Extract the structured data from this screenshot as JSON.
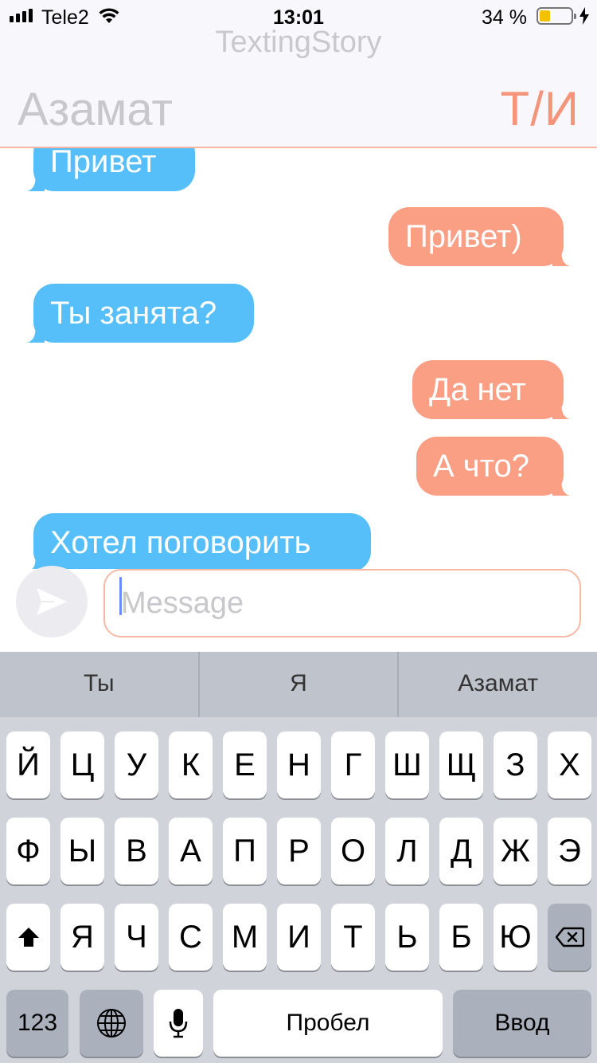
{
  "status_bar": {
    "carrier": "Tele2",
    "time": "13:01",
    "battery_percent_text": "34 %",
    "battery_level": 0.34
  },
  "header": {
    "app_title": "TextingStory",
    "contact_name": "Азамат",
    "initials": "Т/И",
    "accent_color": "#f4947a"
  },
  "messages": [
    {
      "side": "in",
      "text": "Привет"
    },
    {
      "side": "out",
      "text": "Привет)"
    },
    {
      "side": "in",
      "text": "Ты занята?"
    },
    {
      "side": "out",
      "text": "Да нет"
    },
    {
      "side": "out",
      "text": "А что?"
    },
    {
      "side": "in",
      "text": "Хотел поговорить"
    }
  ],
  "colors": {
    "incoming_bubble": "#56bef9",
    "outgoing_bubble": "#fa9e84"
  },
  "composer": {
    "placeholder": "Message",
    "value": ""
  },
  "keyboard": {
    "suggestions": [
      "Ты",
      "Я",
      "Азамат"
    ],
    "row1": [
      "Й",
      "Ц",
      "У",
      "К",
      "Е",
      "Н",
      "Г",
      "Ш",
      "Щ",
      "З",
      "Х"
    ],
    "row2": [
      "Ф",
      "Ы",
      "В",
      "А",
      "П",
      "Р",
      "О",
      "Л",
      "Д",
      "Ж",
      "Э"
    ],
    "row3": [
      "Я",
      "Ч",
      "С",
      "М",
      "И",
      "Т",
      "Ь",
      "Б",
      "Ю"
    ],
    "numbers_label": "123",
    "space_label": "Пробел",
    "enter_label": "Ввод"
  }
}
